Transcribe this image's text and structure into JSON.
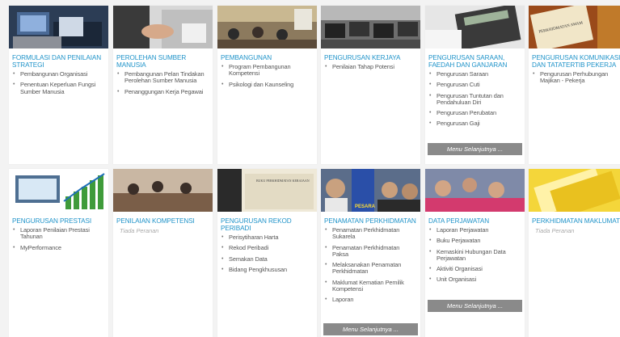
{
  "tiles": [
    {
      "title": "FORMULASI DAN PENILAIAN STRATEGI",
      "items": [
        "Pembangunan Organisasi",
        "Penentuan Keperluan Fungsi Sumber Manusia"
      ]
    },
    {
      "title": "PEROLEHAN SUMBER MANUSIA",
      "items": [
        "Pembangunan Pelan Tindakan Perolehan Sumber Manusia",
        "Penanggungan Kerja Pegawai"
      ]
    },
    {
      "title": "PEMBANGUNAN",
      "items": [
        "Program Pembangunan Kompetensi",
        "Psikologi dan Kaunseling"
      ]
    },
    {
      "title": "PENGURUSAN KERJAYA",
      "items": [
        "Penilaian Tahap Potensi"
      ]
    },
    {
      "title": "PENGURUSAN SARAAN, FAEDAH DAN GANJARAN",
      "items": [
        "Pengurusan Saraan",
        "Pengurusan Cuti",
        "Pengurusan Tuntutan dan Pendahuluan Diri",
        "Pengurusan Perubatan",
        "Pengurusan Gaji"
      ],
      "more": "Menu Selanjutnya ..."
    },
    {
      "title": "PENGURUSAN KOMUNIKASI DAN TATATERTIB PEKERJA",
      "items": [
        "Pengurusan Perhubungan Majikan - Pekerja"
      ]
    },
    {
      "title": "PENGURUSAN PRESTASI",
      "items": [
        "Laporan Penilaian Prestasi Tahunan",
        "MyPerformance"
      ]
    },
    {
      "title": "PENILAIAN KOMPETENSI",
      "none": "Tiada Peranan"
    },
    {
      "title": "PENGURUSAN REKOD PERIBADI",
      "items": [
        "Perisytiharan Harta",
        "Rekod Peribadi",
        "Semakan Data",
        "Bidang Pengkhususan"
      ]
    },
    {
      "title": "PENAMATAN PERKHIDMATAN",
      "items": [
        "Penamatan Perkhidmatan Sukarela",
        "Penamatan Perkhidmatan Paksa",
        "Melaksanakan Penamatan Perkhidmatan",
        "Maklumat Kematian Pemilik Kompetensi",
        "Laporan"
      ],
      "more": "Menu Selanjutnya ..."
    },
    {
      "title": "DATA PERJAWATAN",
      "items": [
        "Laporan Perjawatan",
        "Buku Perjawatan",
        "Kemaskini Hubungan Data Perjawatan",
        "Aktiviti Organisasi",
        "Unit Organisasi"
      ],
      "more": "Menu Selanjutnya ..."
    },
    {
      "title": "PERKHIDMATAN MAKLUMAT",
      "none": "Tiada Peranan"
    }
  ],
  "thumb_labels": {
    "book": "BUKU PERKHIDMATAN KERAJAAN",
    "pesara": "PESARA",
    "comm": "PERKHIDMATAN AWAM"
  },
  "colors": {
    "title": "#1f93c9",
    "more_bg": "#8a8a8a",
    "page_bg": "#f3f3f3"
  }
}
